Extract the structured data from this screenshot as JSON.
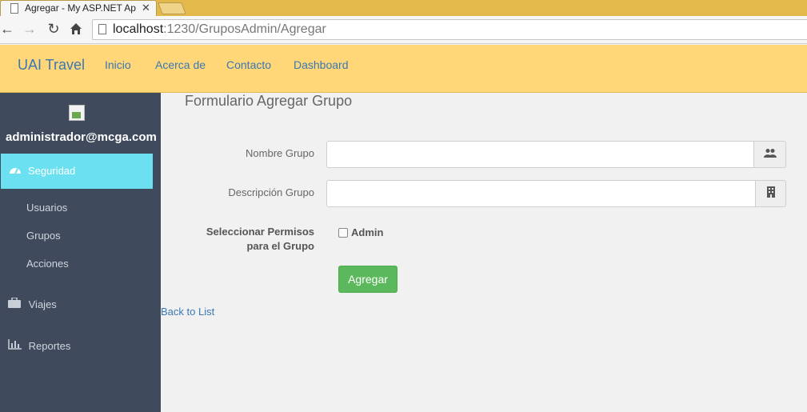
{
  "browser": {
    "tab_title": "Agregar - My ASP.NET Ap",
    "tab_close": "✕",
    "url_host": "localhost",
    "url_path": ":1230/GruposAdmin/Agregar"
  },
  "navbar": {
    "brand": "UAI Travel",
    "links": [
      "Inicio",
      "Acerca de",
      "Contacto",
      "Dashboard"
    ],
    "bg_color": "#ffd778",
    "link_color": "#3b77b3"
  },
  "sidebar": {
    "username": "administrador@mcga.com",
    "active_item": {
      "label": "Seguridad",
      "icon": "dashboard-icon"
    },
    "sub_items": [
      "Usuarios",
      "Grupos",
      "Acciones"
    ],
    "items": [
      {
        "label": "Viajes",
        "icon": "briefcase-icon"
      },
      {
        "label": "Reportes",
        "icon": "bar-chart-icon"
      }
    ],
    "bg_color": "#3f4a5d",
    "active_color": "#6be0f0"
  },
  "form": {
    "title": "Formulario Agregar Grupo",
    "nombre_label": "Nombre Grupo",
    "nombre_value": "",
    "nombre_icon": "users-icon",
    "descripcion_label": "Descripción Grupo",
    "descripcion_value": "",
    "descripcion_icon": "building-icon",
    "permisos_label_line1": "Seleccionar Permisos",
    "permisos_label_line2": "para el Grupo",
    "permiso_option": "Admin",
    "permiso_checked": false,
    "submit_label": "Agregar",
    "submit_color": "#5cb85c",
    "back_link": "Back to List"
  }
}
